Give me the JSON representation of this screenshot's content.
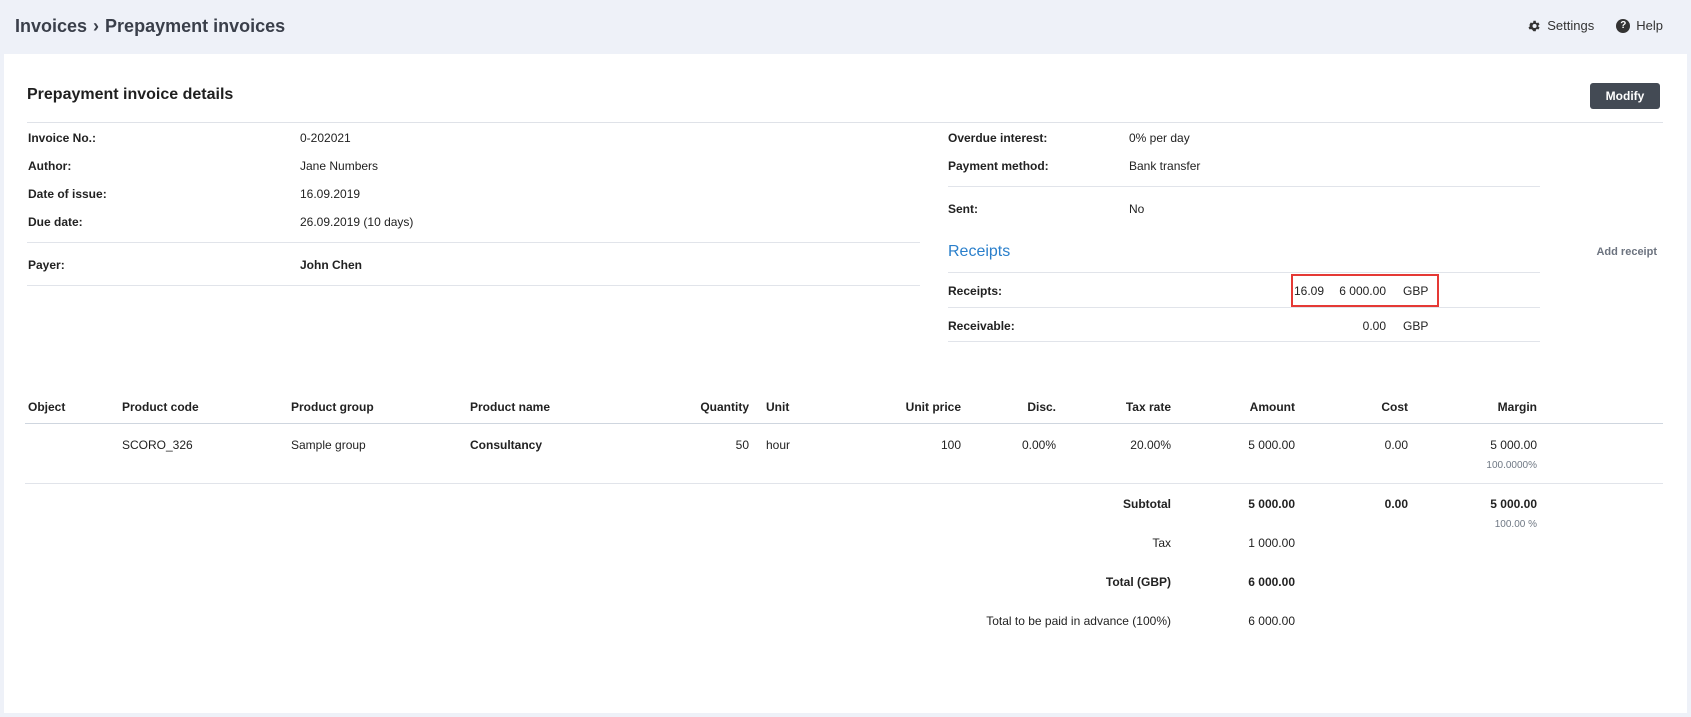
{
  "breadcrumb": {
    "root": "Invoices",
    "separator": "›",
    "current": "Prepayment invoices"
  },
  "top_actions": {
    "settings": "Settings",
    "help": "Help",
    "settings_icon": "gear-icon",
    "help_icon": "question-circle-icon"
  },
  "card": {
    "title": "Prepayment invoice details",
    "modify_label": "Modify"
  },
  "details_left": [
    {
      "label": "Invoice No.:",
      "value": "0-202021"
    },
    {
      "label": "Author:",
      "value": "Jane Numbers"
    },
    {
      "label": "Date of issue:",
      "value": "16.09.2019"
    },
    {
      "label": "Due date:",
      "value": "26.09.2019 (10 days)"
    },
    {
      "label": "Payer:",
      "value": "John Chen"
    }
  ],
  "details_right": [
    {
      "label": "Overdue interest:",
      "value": "0% per day"
    },
    {
      "label": "Payment method:",
      "value": "Bank transfer"
    },
    {
      "label": "Sent:",
      "value": "No"
    }
  ],
  "receipts": {
    "title": "Receipts",
    "add_label": "Add receipt",
    "rows": [
      {
        "label": "Receipts:",
        "date": "16.09",
        "amount": "6 000.00",
        "currency": "GBP"
      },
      {
        "label": "Receivable:",
        "date": "",
        "amount": "0.00",
        "currency": "GBP"
      }
    ]
  },
  "table": {
    "headers": {
      "object": "Object",
      "product_code": "Product code",
      "product_group": "Product group",
      "product_name": "Product name",
      "quantity": "Quantity",
      "unit": "Unit",
      "unit_price": "Unit price",
      "disc": "Disc.",
      "tax_rate": "Tax rate",
      "amount": "Amount",
      "cost": "Cost",
      "margin": "Margin"
    },
    "rows": [
      {
        "object": "",
        "product_code": "SCORO_326",
        "product_group": "Sample group",
        "product_name": "Consultancy",
        "quantity": "50",
        "unit": "hour",
        "unit_price": "100",
        "disc": "0.00%",
        "tax_rate": "20.00%",
        "amount": "5 000.00",
        "cost": "0.00",
        "margin": "5 000.00",
        "margin_pct": "100.0000%"
      }
    ]
  },
  "totals": {
    "subtotal_label": "Subtotal",
    "subtotal_amount": "5 000.00",
    "subtotal_cost": "0.00",
    "subtotal_margin": "5 000.00",
    "subtotal_margin_pct": "100.00 %",
    "tax_label": "Tax",
    "tax_amount": "1 000.00",
    "total_label": "Total (GBP)",
    "total_amount": "6 000.00",
    "advance_label": "Total to be paid in advance (100%)",
    "advance_amount": "6 000.00"
  },
  "colors": {
    "accent": "#2a7fcb",
    "highlight": "#e53935",
    "button": "#434a54",
    "background": "#eef1f8"
  }
}
